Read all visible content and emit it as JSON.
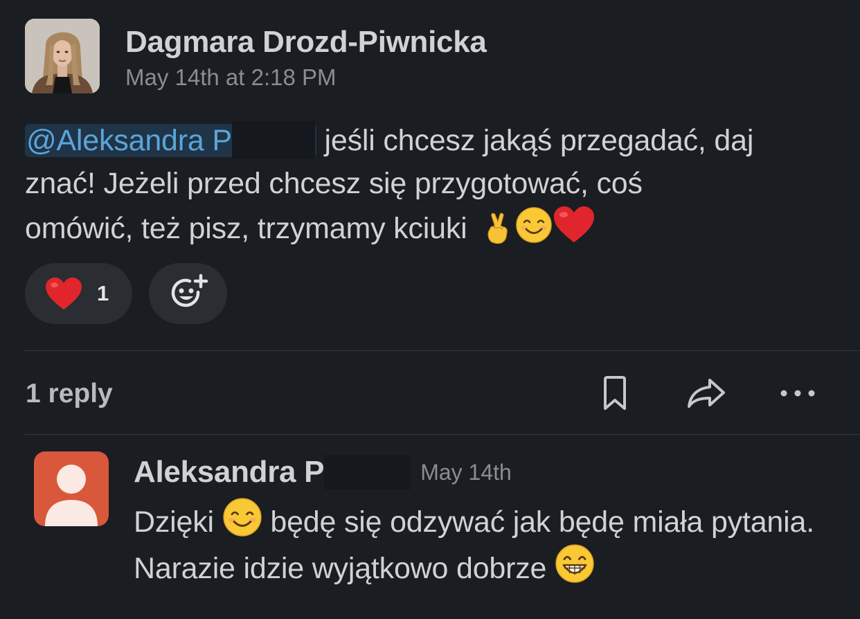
{
  "message": {
    "author": "Dagmara Drozd-Piwnicka",
    "timestamp": "May 14th at 2:18 PM",
    "mention": "@Aleksandra P",
    "text_line_1": " jeśli chcesz jakąś przegadać, daj",
    "text_line_2": "znać! Jeżeli przed chcesz się przygotować, coś",
    "text_line_3": "omówić, też pisz, trzymamy kciuki",
    "trailing_emojis": [
      "crossed-fingers-emoji",
      "smiling-face-emoji",
      "red-heart-emoji"
    ]
  },
  "reactions": [
    {
      "emoji": "red-heart-emoji",
      "count": "1"
    }
  ],
  "add_reaction_icon": "add-reaction-icon",
  "thread": {
    "reply_count": "1 reply"
  },
  "action_icons": [
    "bookmark-icon",
    "share-icon",
    "more-icon"
  ],
  "reply": {
    "author": "Aleksandra P",
    "timestamp": "May 14th",
    "text_part_1": "Dzięki",
    "text_part_2": " będę się odzywać jak będę miała pytania. Narazie idzie wyjątkowo dobrze",
    "emojis": [
      "smiling-face-emoji",
      "grinning-face-emoji"
    ]
  },
  "colors": {
    "background": "#1a1d21",
    "text": "#d1d2d3",
    "muted": "#8b8d90",
    "mention": "#5ba4d9",
    "mention_bg": "#1f3446",
    "pill": "#2a2d31",
    "reply_avatar": "#d9573b"
  }
}
